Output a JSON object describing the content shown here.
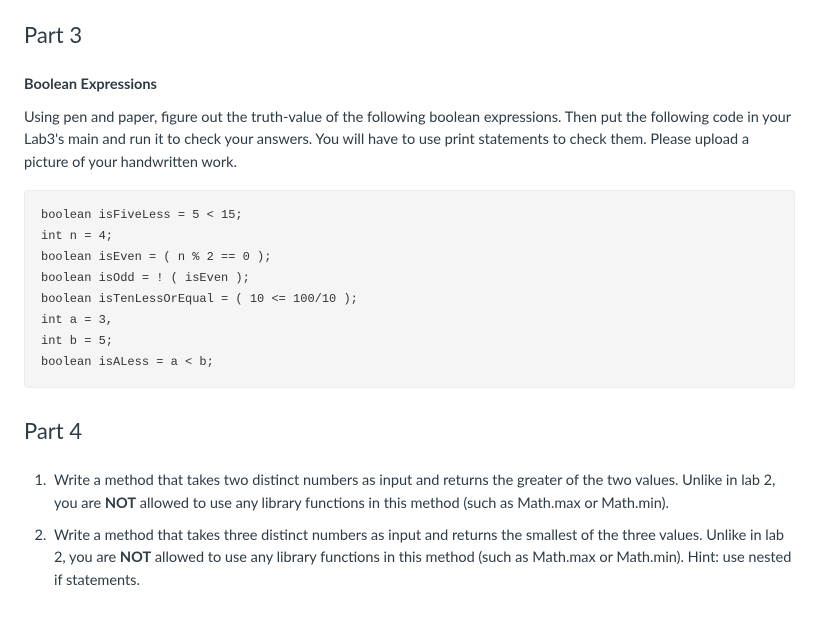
{
  "part3": {
    "title": "Part 3",
    "subhead": "Boolean Expressions",
    "intro": "Using pen and paper, figure out the truth-value of the following boolean expressions. Then put the following code in your Lab3's main and run it to check your answers. You will have to use print statements to check them. Please upload a picture of your handwritten work.",
    "code": "boolean isFiveLess = 5 < 15;\nint n = 4;\nboolean isEven = ( n % 2 == 0 );\nboolean isOdd = ! ( isEven );\nboolean isTenLessOrEqual = ( 10 <= 100/10 );\nint a = 3,\nint b = 5;\nboolean isALess = a < b;"
  },
  "part4": {
    "title": "Part 4",
    "items": [
      {
        "pre": "Write a method that takes two distinct numbers as input and returns the greater of the two values. Unlike in lab 2, you are ",
        "bold": "NOT",
        "post": " allowed to use any library functions in this method (such as Math.max or Math.min)."
      },
      {
        "pre": "Write a method that takes three distinct numbers as input and returns the smallest of the three values. Unlike in lab 2, you are ",
        "bold": "NOT",
        "post": " allowed to use any library functions in this method (such as Math.max or Math.min). Hint: use nested if statements."
      }
    ]
  }
}
